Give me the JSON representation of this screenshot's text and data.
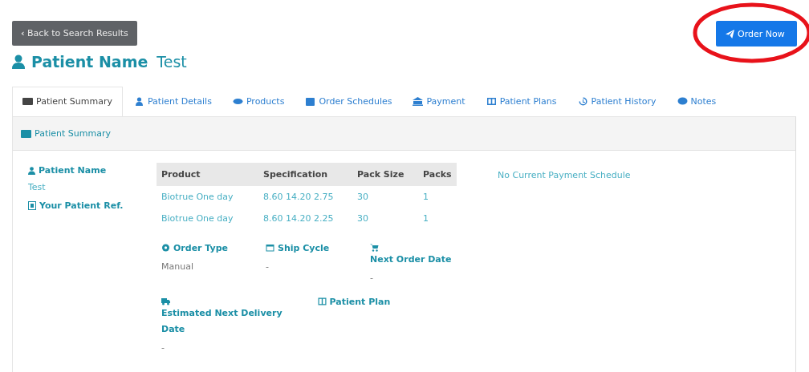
{
  "back_button": {
    "label": "Back to Search Results",
    "icon": "‹"
  },
  "order_button": {
    "label": "Order Now",
    "highlighted": true
  },
  "heading": {
    "label": "Patient Name",
    "value": "Test"
  },
  "tabs": [
    {
      "label": "Patient Summary",
      "selected": true
    },
    {
      "label": "Patient Details",
      "selected": false
    },
    {
      "label": "Products",
      "selected": false
    },
    {
      "label": "Order Schedules",
      "selected": false
    },
    {
      "label": "Payment",
      "selected": false
    },
    {
      "label": "Patient Plans",
      "selected": false
    },
    {
      "label": "Patient History",
      "selected": false
    },
    {
      "label": "Notes",
      "selected": false
    }
  ],
  "panel": {
    "title": "Patient Summary",
    "sidebar": [
      {
        "label": "Patient Name",
        "value": "Test"
      },
      {
        "label": "Your Patient Ref."
      }
    ],
    "table": {
      "columns": [
        "Product",
        "Specification",
        "Pack Size",
        "Packs"
      ],
      "rows": [
        [
          "Biotrue One day",
          "8.60 14.20 2.75",
          "30",
          "1"
        ],
        [
          "Biotrue One day",
          "8.60 14.20 2.25",
          "30",
          "1"
        ]
      ]
    },
    "field_rows": [
      [
        {
          "label": "Order Type",
          "value": "Manual",
          "kind": "inline"
        },
        {
          "label": "Ship Cycle",
          "value": "-",
          "kind": "inline"
        },
        {
          "label": "Next Order Date",
          "value": "-",
          "kind": "stacked"
        }
      ],
      [
        {
          "label": "Estimated Next Delivery Date",
          "value": "-",
          "kind": "stacked"
        },
        {
          "label": "Patient Plan",
          "kind": "inline"
        }
      ]
    ],
    "payment_note": "No Current Payment Schedule"
  }
}
